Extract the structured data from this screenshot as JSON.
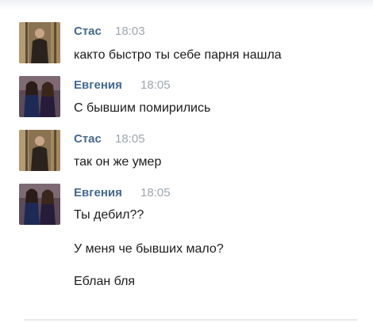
{
  "messages": [
    {
      "sender": "Стас",
      "time": "18:03",
      "lines": [
        "както быстро ты себе парня нашла"
      ],
      "avatar": "man-in-forest-photo"
    },
    {
      "sender": "Евгения",
      "time": "18:05",
      "lines": [
        "С бывшим помирились"
      ],
      "avatar": "two-women-photo"
    },
    {
      "sender": "Стас",
      "time": "18:05",
      "lines": [
        "так он же умер"
      ],
      "avatar": "man-in-forest-photo"
    },
    {
      "sender": "Евгения",
      "time": "18:05",
      "lines": [
        "Ты дебил??",
        "У меня че бывших мало?",
        "Еблан бля"
      ],
      "avatar": "two-women-photo"
    }
  ],
  "colors": {
    "name": "#44698f",
    "time": "#9da6b0",
    "text": "#1c1c1c"
  }
}
